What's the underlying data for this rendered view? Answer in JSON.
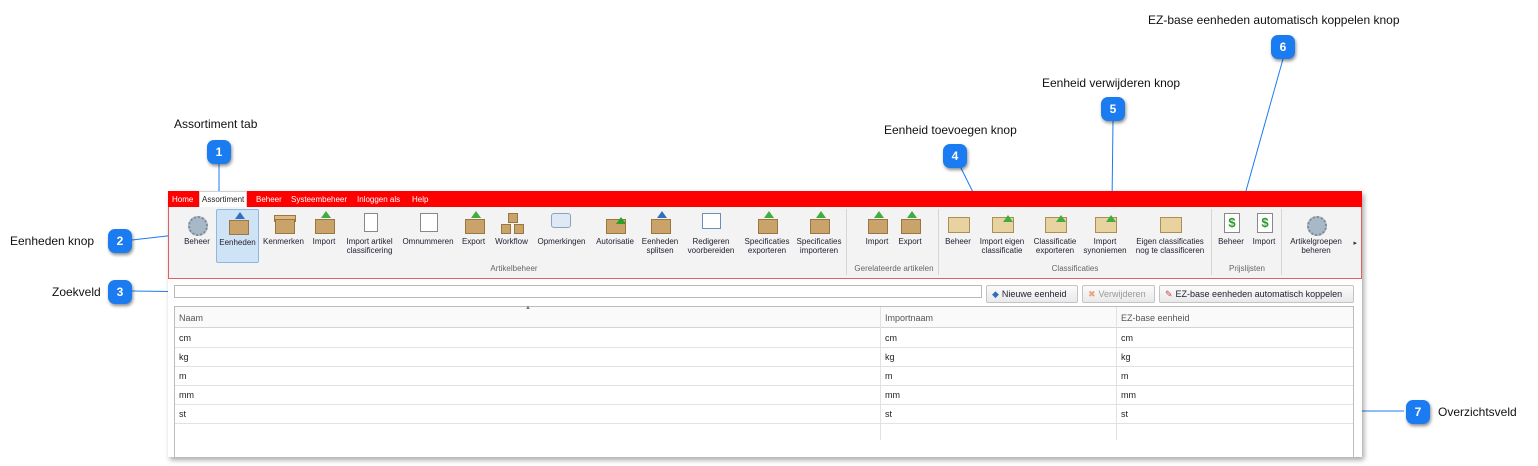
{
  "callouts": [
    {
      "num": "1",
      "label": "Assortiment tab"
    },
    {
      "num": "2",
      "label": "Eenheden knop"
    },
    {
      "num": "3",
      "label": "Zoekveld"
    },
    {
      "num": "4",
      "label": "Eenheid toevoegen knop"
    },
    {
      "num": "5",
      "label": "Eenheid verwijderen knop"
    },
    {
      "num": "6",
      "label": "EZ-base eenheden automatisch koppelen knop"
    },
    {
      "num": "7",
      "label": "Overzichtsveld"
    }
  ],
  "menu": {
    "items": [
      "Home",
      "Assortiment",
      "Beheer",
      "Systeembeheer",
      "Inloggen als",
      "Help"
    ],
    "active": "Assortiment"
  },
  "ribbon": {
    "artikelbeheer": {
      "label": "Artikelbeheer",
      "buttons": [
        "Beheer",
        "Eenheden",
        "Kenmerken",
        "Import",
        "Import artikel classificering",
        "Omnummeren",
        "Export",
        "Workflow",
        "Opmerkingen",
        "Autorisatie",
        "Eenheden splitsen",
        "Redigeren voorbereiden",
        "Specificaties exporteren",
        "Specificaties importeren"
      ]
    },
    "gerelateerde": {
      "label": "Gerelateerde artikelen",
      "buttons": [
        "Import",
        "Export"
      ]
    },
    "classificaties": {
      "label": "Classificaties",
      "buttons": [
        "Beheer",
        "Import eigen classificatie",
        "Classificatie exporteren",
        "Import synoniemen",
        "Eigen classificaties nog te classificeren"
      ]
    },
    "prijslijsten": {
      "label": "Prijslijsten",
      "buttons": [
        "Beheer",
        "Import"
      ]
    },
    "artikelgroepen": {
      "buttons": [
        "Artikelgroepen beheren"
      ]
    }
  },
  "search": {
    "value": "",
    "placeholder": ""
  },
  "toolbar": {
    "new_label": "Nieuwe eenheid",
    "delete_label": "Verwijderen",
    "couple_label": "EZ-base eenheden automatisch koppelen"
  },
  "grid": {
    "columns": [
      "Naam",
      "Importnaam",
      "EZ-base eenheid"
    ],
    "rows": [
      [
        "cm",
        "cm",
        "cm"
      ],
      [
        "kg",
        "kg",
        "kg"
      ],
      [
        "m",
        "m",
        "m"
      ],
      [
        "mm",
        "mm",
        "mm"
      ],
      [
        "st",
        "st",
        "st"
      ]
    ]
  },
  "colors": {
    "menubar": "#ff0000",
    "callout": "#1a7cf0",
    "selected": "#cfe3f7"
  }
}
